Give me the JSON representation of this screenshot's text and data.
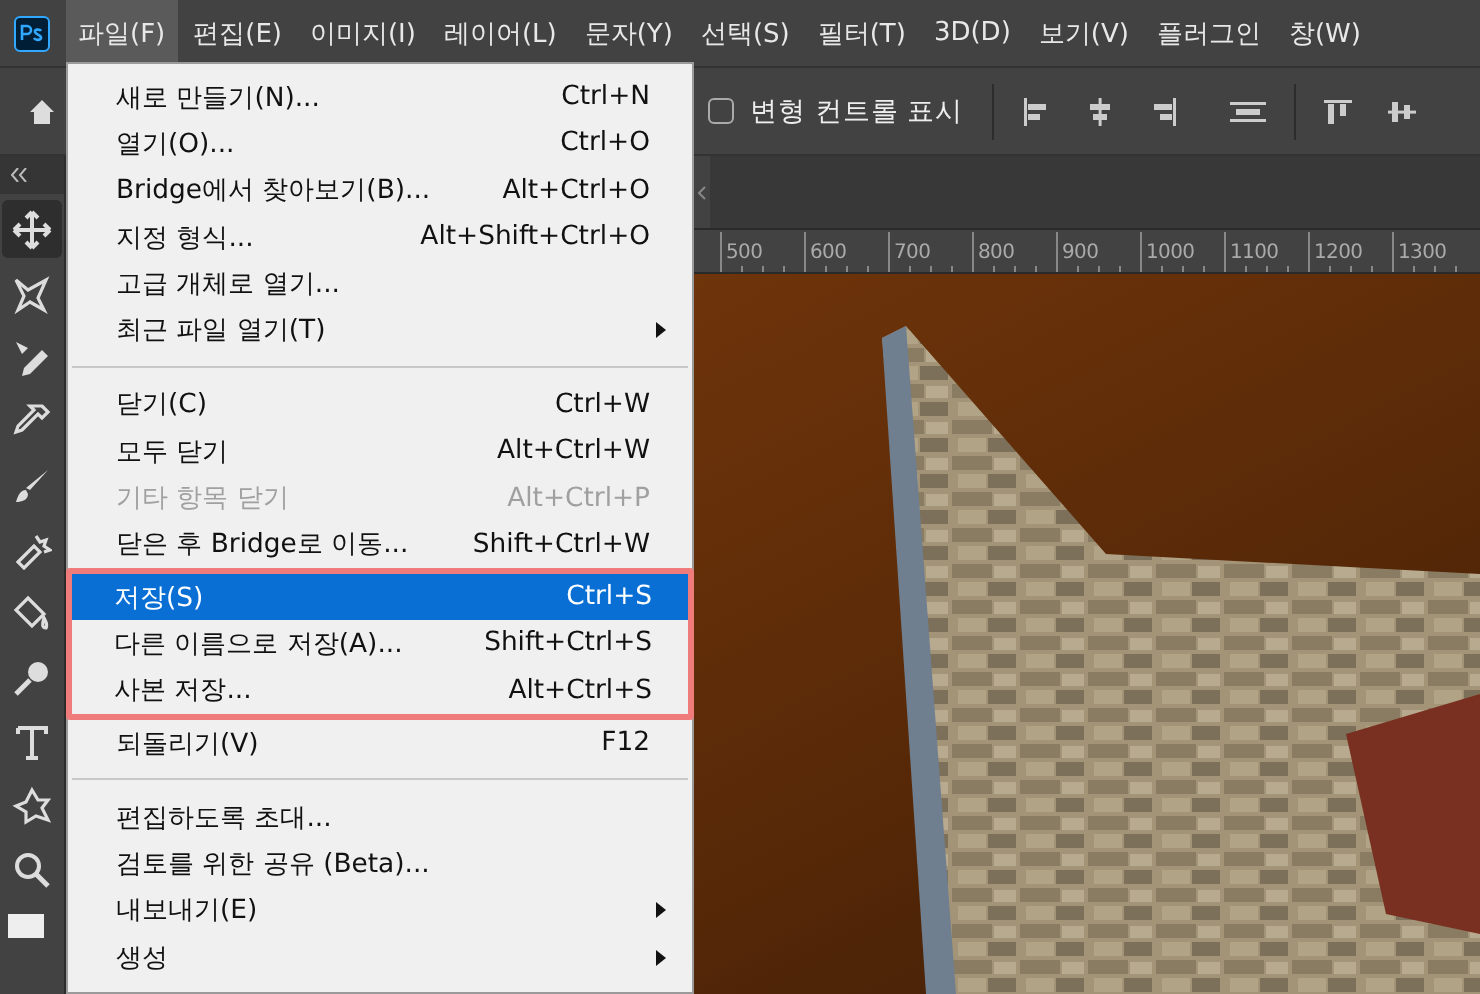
{
  "menubar": {
    "items": [
      {
        "label": "파일(F)",
        "selected": true
      },
      {
        "label": "편집(E)",
        "selected": false
      },
      {
        "label": "이미지(I)",
        "selected": false
      },
      {
        "label": "레이어(L)",
        "selected": false
      },
      {
        "label": "문자(Y)",
        "selected": false
      },
      {
        "label": "선택(S)",
        "selected": false
      },
      {
        "label": "필터(T)",
        "selected": false
      },
      {
        "label": "3D(D)",
        "selected": false
      },
      {
        "label": "보기(V)",
        "selected": false
      },
      {
        "label": "플러그인",
        "selected": false
      },
      {
        "label": "창(W)",
        "selected": false
      }
    ]
  },
  "options_bar": {
    "transform_controls": {
      "label": "변형 컨트롤 표시",
      "checked": false
    }
  },
  "toolbar": {
    "tools": [
      {
        "selected": true
      },
      {
        "selected": false
      },
      {
        "selected": false
      },
      {
        "selected": false
      },
      {
        "selected": false
      },
      {
        "selected": false
      },
      {
        "selected": false
      },
      {
        "selected": false
      },
      {
        "selected": false
      },
      {
        "selected": false
      },
      {
        "selected": false
      }
    ]
  },
  "ruler": {
    "labels": [
      "500",
      "600",
      "700",
      "800",
      "900",
      "1000",
      "1100",
      "1200",
      "1300"
    ]
  },
  "file_menu": {
    "sections": [
      {
        "groups": [
          {
            "outlined": false,
            "items": [
              {
                "label": "새로 만들기(N)...",
                "shortcut": "Ctrl+N",
                "disabled": false,
                "selected": false,
                "submenu": false
              },
              {
                "label": "열기(O)...",
                "shortcut": "Ctrl+O",
                "disabled": false,
                "selected": false,
                "submenu": false
              },
              {
                "label": "Bridge에서 찾아보기(B)...",
                "shortcut": "Alt+Ctrl+O",
                "disabled": false,
                "selected": false,
                "submenu": false
              },
              {
                "label": "지정 형식...",
                "shortcut": "Alt+Shift+Ctrl+O",
                "disabled": false,
                "selected": false,
                "submenu": false
              },
              {
                "label": "고급 개체로 열기...",
                "disabled": false,
                "selected": false,
                "submenu": false
              },
              {
                "label": "최근 파일 열기(T)",
                "disabled": false,
                "selected": false,
                "submenu": true
              }
            ]
          }
        ]
      },
      {
        "groups": [
          {
            "outlined": false,
            "items": [
              {
                "label": "닫기(C)",
                "shortcut": "Ctrl+W",
                "disabled": false,
                "selected": false,
                "submenu": false
              },
              {
                "label": "모두 닫기",
                "shortcut": "Alt+Ctrl+W",
                "disabled": false,
                "selected": false,
                "submenu": false
              },
              {
                "label": "기타 항목 닫기",
                "shortcut": "Alt+Ctrl+P",
                "disabled": true,
                "selected": false,
                "submenu": false
              },
              {
                "label": "닫은 후 Bridge로 이동...",
                "shortcut": "Shift+Ctrl+W",
                "disabled": false,
                "selected": false,
                "submenu": false
              }
            ]
          },
          {
            "outlined": true,
            "items": [
              {
                "label": "저장(S)",
                "shortcut": "Ctrl+S",
                "disabled": false,
                "selected": true,
                "submenu": false
              },
              {
                "label": "다른 이름으로 저장(A)...",
                "shortcut": "Shift+Ctrl+S",
                "disabled": false,
                "selected": false,
                "submenu": false
              },
              {
                "label": "사본 저장...",
                "shortcut": "Alt+Ctrl+S",
                "disabled": false,
                "selected": false,
                "submenu": false
              }
            ]
          },
          {
            "outlined": false,
            "items": [
              {
                "label": "되돌리기(V)",
                "shortcut": "F12",
                "disabled": false,
                "selected": false,
                "submenu": false
              }
            ]
          }
        ]
      },
      {
        "groups": [
          {
            "outlined": false,
            "items": [
              {
                "label": "편집하도록 초대...",
                "disabled": false,
                "selected": false,
                "submenu": false
              },
              {
                "label": "검토를 위한 공유 (Beta)...",
                "disabled": false,
                "selected": false,
                "submenu": false
              },
              {
                "label": "내보내기(E)",
                "disabled": false,
                "selected": false,
                "submenu": true
              },
              {
                "label": "생성",
                "disabled": false,
                "selected": false,
                "submenu": true
              }
            ]
          }
        ]
      }
    ]
  }
}
